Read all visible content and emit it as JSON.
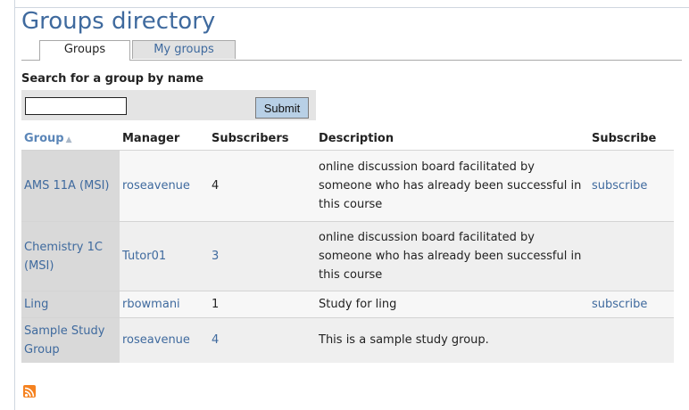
{
  "page": {
    "title": "Groups directory"
  },
  "tabs": [
    {
      "label": "Groups"
    },
    {
      "label": "My groups"
    }
  ],
  "search": {
    "label": "Search for a group by name",
    "value": "",
    "submit_label": "Submit"
  },
  "table": {
    "headers": {
      "group": "Group",
      "manager": "Manager",
      "subscribers": "Subscribers",
      "description": "Description",
      "subscribe": "Subscribe"
    },
    "sort_icon": "sort-ascending-icon",
    "rows": [
      {
        "group": "AMS 11A (MSI)",
        "manager": "roseavenue",
        "subscribers": "4",
        "description": "online discussion board facilitated by someone who has already been successful in this course",
        "subscribe": "subscribe"
      },
      {
        "group": "Chemistry 1C (MSI)",
        "manager": "Tutor01",
        "subscribers": "3",
        "description": "online discussion board facilitated by someone who has already been successful in this course",
        "subscribe": ""
      },
      {
        "group": "Ling",
        "manager": "rbowmani",
        "subscribers": "1",
        "description": "Study for ling",
        "subscribe": "subscribe"
      },
      {
        "group": "Sample Study Group",
        "manager": "roseavenue",
        "subscribers": "4",
        "description": "This is a sample study group.",
        "subscribe": ""
      }
    ]
  },
  "footer": {
    "icon": "rss-feed-icon"
  },
  "colors": {
    "link": "#3f6a9e",
    "title": "#3f6a9e",
    "rss": "#f58220",
    "button": "#b8d0e6"
  }
}
